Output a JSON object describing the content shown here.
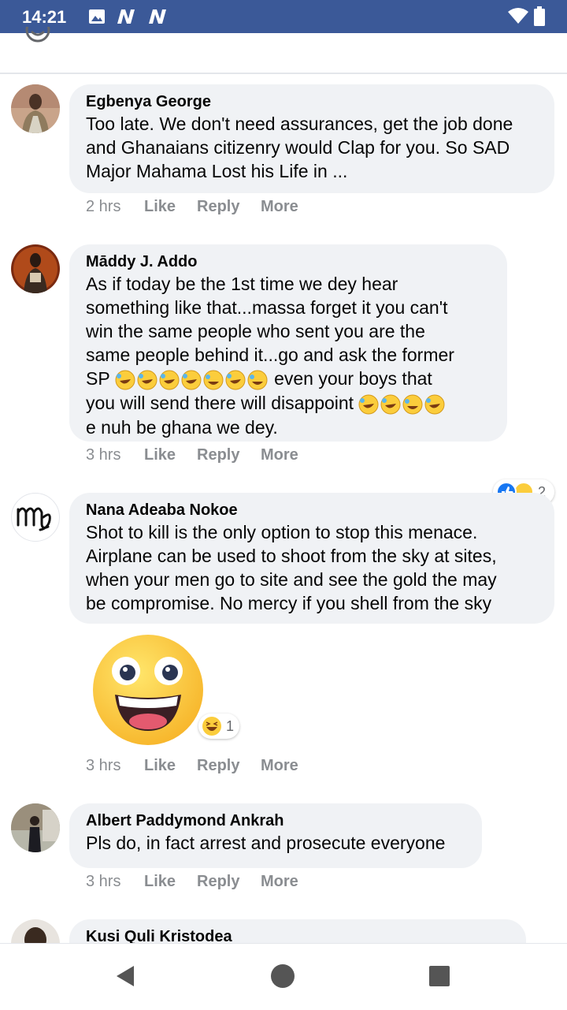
{
  "status_bar": {
    "time": "14:21",
    "bg_color": "#3b5998",
    "icons": [
      "image-icon",
      "n-notification-icon",
      "n-notification-icon",
      "wifi-icon",
      "battery-icon"
    ]
  },
  "comments": [
    {
      "name": "Egbenya George",
      "lines": [
        "Too late. We don't need assurances, get the job done",
        "and Ghanaians citizenry would Clap for you. So SAD",
        "Major Mahama Lost his Life in ..."
      ],
      "time": "2 hrs"
    },
    {
      "name": "Māddy J. Addo",
      "lines": [
        "As if today be the 1st time we dey hear",
        "something like that...massa forget it you can't",
        "win the same people who sent you are the",
        "same people behind it...go and ask the former",
        "SP",
        "even your boys that",
        "you will send there will disappoint",
        "e nuh be ghana we dey."
      ],
      "reaction_count": "2",
      "time": "3 hrs"
    },
    {
      "name": "Nana Adeaba Nokoe",
      "lines": [
        "Shot to kill is the only option to stop this menace.",
        "Airplane can be used to shoot from the sky at sites,",
        "when your men go to site and see the gold the may",
        "be compromise. No mercy if you shell from the sky"
      ],
      "reaction_count": "1",
      "time": "3 hrs"
    },
    {
      "name": "Albert Paddymond Ankrah",
      "lines": [
        "Pls do, in fact arrest and prosecute everyone"
      ],
      "time": "3 hrs"
    },
    {
      "name": "Kusi Quli Kristodea"
    }
  ],
  "actions": {
    "like": "Like",
    "reply": "Reply",
    "more": "More"
  },
  "colors": {
    "bubble": "#f0f2f5",
    "meta_text": "#8a8d91",
    "like_blue": "#1877f2",
    "emoji_yellow": "#fbcd3c"
  }
}
